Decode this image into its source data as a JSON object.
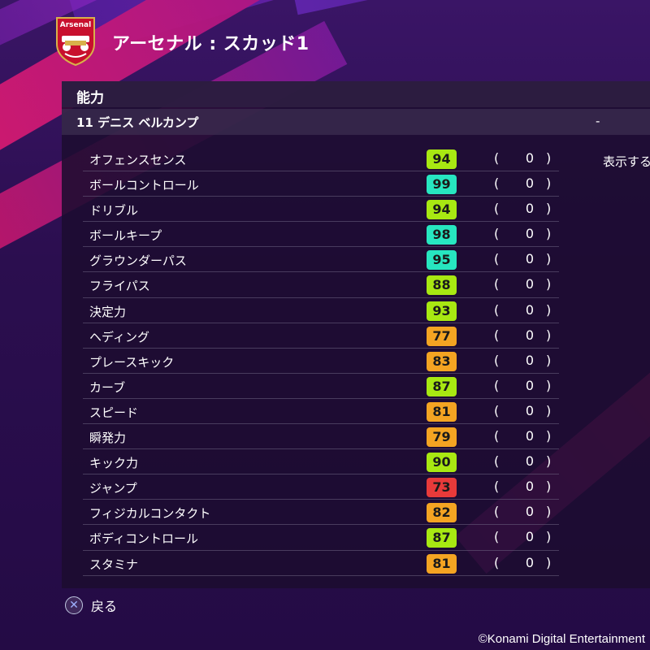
{
  "header": {
    "crest_text": "Arsenal",
    "title": "アーセナル : スカッド1"
  },
  "panel": {
    "title": "能力",
    "player_name": "11 デニス ベルカンプ",
    "player_value": "-",
    "side_label": "表示する"
  },
  "stats": [
    {
      "label": "オフェンスセンス",
      "value": "94",
      "bonus": "0",
      "tier": "green"
    },
    {
      "label": "ボールコントロール",
      "value": "99",
      "bonus": "0",
      "tier": "cyan"
    },
    {
      "label": "ドリブル",
      "value": "94",
      "bonus": "0",
      "tier": "green"
    },
    {
      "label": "ボールキープ",
      "value": "98",
      "bonus": "0",
      "tier": "cyan"
    },
    {
      "label": "グラウンダーパス",
      "value": "95",
      "bonus": "0",
      "tier": "cyan"
    },
    {
      "label": "フライパス",
      "value": "88",
      "bonus": "0",
      "tier": "green"
    },
    {
      "label": "決定力",
      "value": "93",
      "bonus": "0",
      "tier": "green"
    },
    {
      "label": "ヘディング",
      "value": "77",
      "bonus": "0",
      "tier": "orange"
    },
    {
      "label": "プレースキック",
      "value": "83",
      "bonus": "0",
      "tier": "orange"
    },
    {
      "label": "カーブ",
      "value": "87",
      "bonus": "0",
      "tier": "green"
    },
    {
      "label": "スピード",
      "value": "81",
      "bonus": "0",
      "tier": "orange"
    },
    {
      "label": "瞬発力",
      "value": "79",
      "bonus": "0",
      "tier": "orange"
    },
    {
      "label": "キック力",
      "value": "90",
      "bonus": "0",
      "tier": "green"
    },
    {
      "label": "ジャンプ",
      "value": "73",
      "bonus": "0",
      "tier": "red"
    },
    {
      "label": "フィジカルコンタクト",
      "value": "82",
      "bonus": "0",
      "tier": "orange"
    },
    {
      "label": "ボディコントロール",
      "value": "87",
      "bonus": "0",
      "tier": "green"
    },
    {
      "label": "スタミナ",
      "value": "81",
      "bonus": "0",
      "tier": "orange"
    }
  ],
  "tier_colors": {
    "green": "#a8e812",
    "cyan": "#27e6c0",
    "orange": "#f4a422",
    "red": "#e83a3a"
  },
  "footer": {
    "back_icon": "cross-button-icon",
    "back_label": "戻る",
    "copyright": "©Konami Digital Entertainment"
  }
}
